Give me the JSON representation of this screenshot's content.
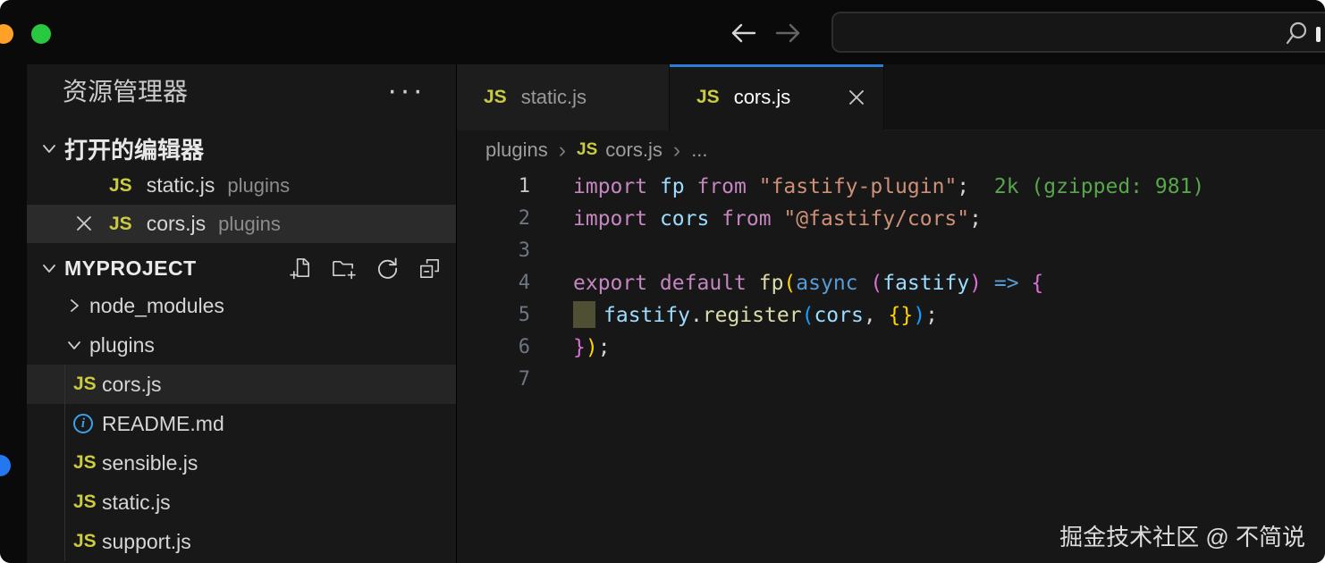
{
  "titlebar": {
    "traffic_lights": [
      "minimize",
      "zoom"
    ],
    "nav": {
      "back": "back",
      "forward": "forward"
    },
    "search": {
      "value": ""
    }
  },
  "icons": {
    "js": "JS",
    "info": "i",
    "more": "···",
    "breadcrumb_sep": "›"
  },
  "sidebar": {
    "title": "资源管理器",
    "open_editors": {
      "label": "打开的编辑器",
      "items": [
        {
          "icon": "js",
          "name": "static.js",
          "badge": "plugins",
          "selected": false,
          "closable": false
        },
        {
          "icon": "js",
          "name": "cors.js",
          "badge": "plugins",
          "selected": true,
          "closable": true
        }
      ]
    },
    "project": {
      "name": "MYPROJECT",
      "actions": [
        "new-file",
        "new-folder",
        "refresh-explorer",
        "collapse-folders"
      ],
      "tree": [
        {
          "kind": "folder",
          "name": "node_modules",
          "expanded": false
        },
        {
          "kind": "folder",
          "name": "plugins",
          "expanded": true
        },
        {
          "kind": "file",
          "icon": "js",
          "name": "cors.js",
          "selected": true
        },
        {
          "kind": "file",
          "icon": "info",
          "name": "README.md",
          "selected": false
        },
        {
          "kind": "file",
          "icon": "js",
          "name": "sensible.js",
          "selected": false
        },
        {
          "kind": "file",
          "icon": "js",
          "name": "static.js",
          "selected": false
        },
        {
          "kind": "file",
          "icon": "js",
          "name": "support.js",
          "selected": false
        }
      ]
    }
  },
  "tabs": [
    {
      "icon": "js",
      "label": "static.js",
      "active": false,
      "closable": false
    },
    {
      "icon": "js",
      "label": "cors.js",
      "active": true,
      "closable": true
    }
  ],
  "breadcrumb": {
    "items": [
      "plugins",
      "cors.js",
      "..."
    ]
  },
  "editor": {
    "active_line": 1,
    "lines": [
      {
        "n": 1,
        "tokens": [
          [
            "kw",
            "import "
          ],
          [
            "var",
            "fp"
          ],
          [
            "kw",
            " from "
          ],
          [
            "str",
            "\"fastify-plugin\""
          ],
          [
            "pun",
            ";"
          ],
          [
            "cost",
            "  2k (gzipped: 981)"
          ]
        ]
      },
      {
        "n": 2,
        "tokens": [
          [
            "kw",
            "import "
          ],
          [
            "var",
            "cors"
          ],
          [
            "kw",
            " from "
          ],
          [
            "str",
            "\"@fastify/cors\""
          ],
          [
            "pun",
            ";"
          ]
        ]
      },
      {
        "n": 3,
        "tokens": []
      },
      {
        "n": 4,
        "tokens": [
          [
            "kw",
            "export default "
          ],
          [
            "fn",
            "fp"
          ],
          [
            "b1",
            "("
          ],
          [
            "op",
            "async "
          ],
          [
            "b2",
            "("
          ],
          [
            "var",
            "fastify"
          ],
          [
            "b2",
            ")"
          ],
          [
            "op",
            " => "
          ],
          [
            "b2",
            "{"
          ]
        ]
      },
      {
        "n": 5,
        "tokens": [
          [
            "block",
            ""
          ],
          [
            "var",
            "fastify"
          ],
          [
            "pun",
            "."
          ],
          [
            "fn",
            "register"
          ],
          [
            "b3",
            "("
          ],
          [
            "var",
            "cors"
          ],
          [
            "pun",
            ", "
          ],
          [
            "b1",
            "{}"
          ],
          [
            "b3",
            ")"
          ],
          [
            "pun",
            ";"
          ]
        ]
      },
      {
        "n": 6,
        "tokens": [
          [
            "b2",
            "}"
          ],
          [
            "b1",
            ")"
          ],
          [
            "pun",
            ";"
          ]
        ]
      },
      {
        "n": 7,
        "tokens": []
      }
    ]
  },
  "watermark": "掘金技术社区 @ 不简说",
  "colors": {
    "active_tab_border": "#2b7cd9",
    "js_badge": "#cbcb41",
    "import_cost_green": "#57a64a",
    "traffic_orange": "#ffa028",
    "traffic_green": "#28c840",
    "notification_blue": "#2577f0",
    "info_icon_blue": "#3aa3e8",
    "string": "#ce9178",
    "keyword": "#c586c0",
    "identifier": "#9cdcfe",
    "function": "#dcdcaa"
  }
}
